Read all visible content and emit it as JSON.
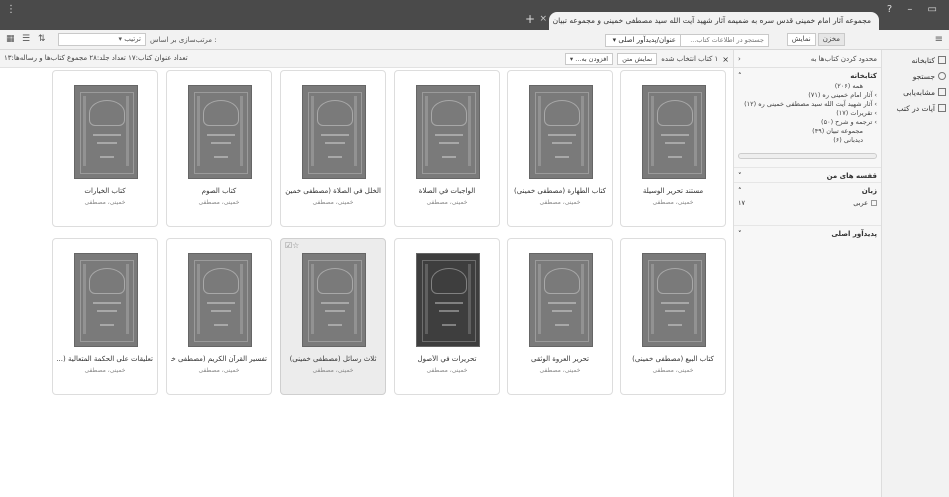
{
  "titlebar": {
    "tab_title": "مجموعه آثار امام خمینی قدس سره به ضمیمه آثار شهید آیت الله سید مصطفی خمینی و مجموعه تبیان",
    "tab_close": "×",
    "new_tab": "+",
    "win_controls_left": "⋮",
    "win_buttons": "? – ▭"
  },
  "toolbar": {
    "sort_label": "مرتب‌سازی بر اساس :",
    "sort_value": "ترتیب",
    "search_field": "عنوان/پدیدآور اصلی",
    "search_placeholder": "جستجو در اطلاعات کتاب...",
    "view_store": "مخزن",
    "view_display": "نمایش",
    "menu": "≡"
  },
  "nav": {
    "items": [
      {
        "label": "کتابخانه"
      },
      {
        "label": "جستجو"
      },
      {
        "label": "مشابه‌یابی"
      },
      {
        "label": "آیات در کتب"
      }
    ]
  },
  "filter": {
    "header": "محدود کردن کتاب‌ها به",
    "library_title": "کتابخانه",
    "library_items": [
      {
        "label": "همه (۲۰۶)",
        "indent": true
      },
      {
        "label": "آثار امام خمینی ره (۷۱)",
        "indent": false
      },
      {
        "label": "آثار شهید آیت الله سید مصطفی خمینی ره (۱۲)",
        "indent": false
      },
      {
        "label": "تقریرات (۱۷)",
        "indent": false
      },
      {
        "label": "ترجمه و شرح (۵۰)",
        "indent": false
      },
      {
        "label": "مجموعه تبیان (۴۹)",
        "indent": true
      },
      {
        "label": "دیدبانی (۶)",
        "indent": true
      }
    ],
    "shelves_title": "قفسه های من",
    "language_title": "زبان",
    "language_item": "عربی",
    "language_count": "۱۷",
    "author_title": "پدیدآور اصلی"
  },
  "content_header": {
    "stats": "تعداد عنوان کتاب:۱۷   تعداد جلد:۲۸   مجموع کتاب‌ها و رساله‌ها:۱۳",
    "selected": "۱ کتاب انتخاب شده",
    "show_text": "نمایش متن",
    "add_to": "افزودن به..."
  },
  "books": [
    {
      "title": "مستند تحریر الوسیلة",
      "author": "خمینی، مصطفی",
      "selected": false
    },
    {
      "title": "کتاب الطهارة (مصطفی خمینی)",
      "author": "خمینی، مصطفی",
      "selected": false
    },
    {
      "title": "الواجبات في الصلاة",
      "author": "خمینی، مصطفی",
      "selected": false
    },
    {
      "title": "الخلل في الصلاة (مصطفی خمین...",
      "author": "خمینی، مصطفی",
      "selected": false
    },
    {
      "title": "کتاب الصوم",
      "author": "خمینی، مصطفی",
      "selected": false
    },
    {
      "title": "کتاب الخیارات",
      "author": "خمینی، مصطفی",
      "selected": false
    },
    {
      "title": "کتاب البیع (مصطفی خمینی)",
      "author": "خمینی، مصطفی",
      "selected": false
    },
    {
      "title": "تحریر العروة الوثقی",
      "author": "خمینی، مصطفی",
      "selected": false
    },
    {
      "title": "تحریرات في الأصول",
      "author": "خمینی، مصطفی",
      "selected": false
    },
    {
      "title": "ثلاث رسائل (مصطفی خمینی)",
      "author": "خمینی، مصطفی",
      "selected": true
    },
    {
      "title": "تفسیر القرآن الکریم (مصطفی خـ...",
      "author": "خمینی، مصطفی",
      "selected": false
    },
    {
      "title": "تعلیقات علی الحکمة المتعالیة (...",
      "author": "خمینی، مصطفی",
      "selected": false
    }
  ],
  "card_icons": "☑☆",
  "colors": {
    "titlebar": "#4a4a4a",
    "cover": "#7a7a7a",
    "cover_dark": "#3e3e3e"
  }
}
